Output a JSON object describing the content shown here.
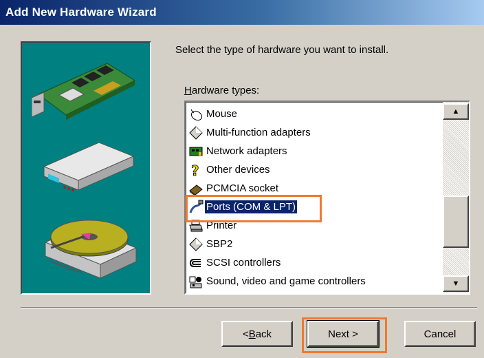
{
  "window": {
    "title": "Add New Hardware Wizard"
  },
  "content": {
    "prompt": "Select the type of hardware you want to install.",
    "list_label_prefix": "",
    "list_label_key": "H",
    "list_label_rest": "ardware types:"
  },
  "hardware_types": [
    {
      "label": "Mouse",
      "icon": "mouse-icon"
    },
    {
      "label": "Multi-function adapters",
      "icon": "diamond-device-icon"
    },
    {
      "label": "Network adapters",
      "icon": "network-adapter-icon"
    },
    {
      "label": "Other devices",
      "icon": "question-mark-icon"
    },
    {
      "label": "PCMCIA socket",
      "icon": "pcmcia-icon"
    },
    {
      "label": "Ports (COM & LPT)",
      "icon": "port-cable-icon",
      "selected": true
    },
    {
      "label": "Printer",
      "icon": "printer-icon"
    },
    {
      "label": "SBP2",
      "icon": "diamond-device-icon"
    },
    {
      "label": "SCSI controllers",
      "icon": "scsi-icon"
    },
    {
      "label": "Sound, video and game controllers",
      "icon": "sound-video-icon"
    }
  ],
  "buttons": {
    "back_prefix": "< ",
    "back_key": "B",
    "back_rest": "ack",
    "next": "Next >",
    "cancel": "Cancel"
  },
  "colors": {
    "highlight": "#f07a2e",
    "selection": "#0a246a",
    "illustration_bg": "#008080"
  }
}
